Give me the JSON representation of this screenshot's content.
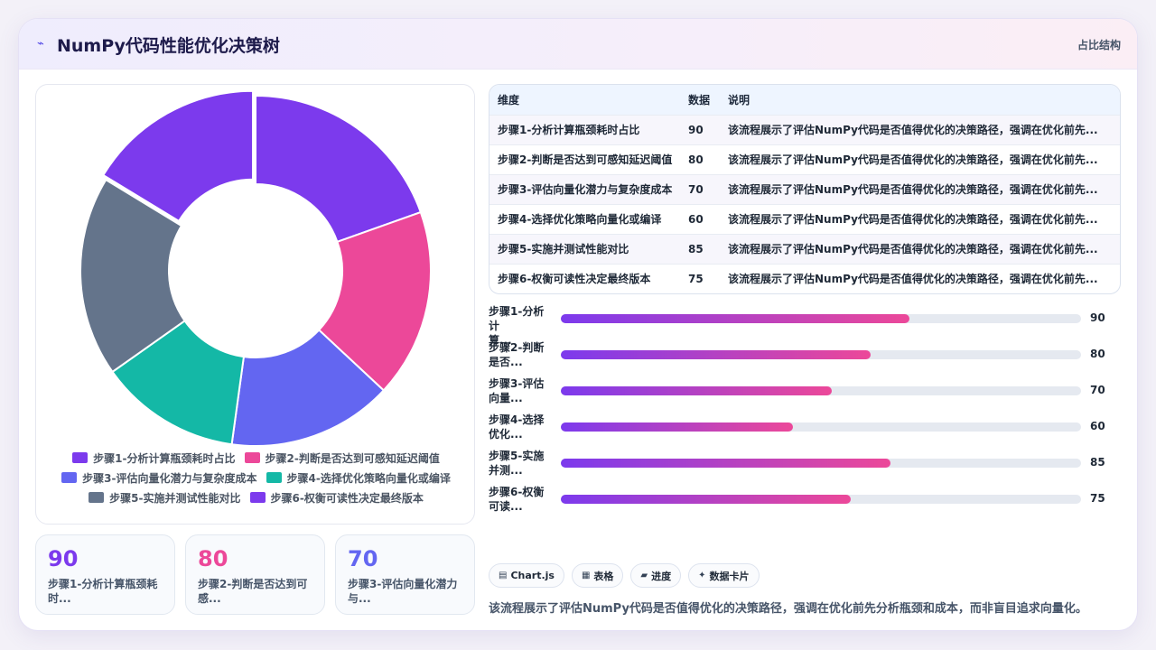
{
  "header": {
    "logo_icon": "chart-line-icon",
    "title": "NumPy代码性能优化决策树",
    "tag": "占比结构"
  },
  "chart_data": {
    "type": "pie",
    "variant": "doughnut",
    "categories": [
      "步骤1-分析计算瓶颈耗时占比",
      "步骤2-判断是否达到可感知延迟阈值",
      "步骤3-评估向量化潜力与复杂度成本",
      "步骤4-选择优化策略向量化或编译",
      "步骤5-实施并测试性能对比",
      "步骤6-权衡可读性决定最终版本"
    ],
    "values": [
      90,
      80,
      70,
      60,
      85,
      75
    ],
    "colors": [
      "#7c3aed",
      "#ec4899",
      "#6366f1",
      "#14b8a6",
      "#64748b",
      "#7c3aed"
    ],
    "legend_position": "bottom",
    "offset_slice_index": 5
  },
  "stat_cards": [
    {
      "value": "90",
      "label": "步骤1-分析计算瓶颈耗时...",
      "color": "#7c3aed"
    },
    {
      "value": "80",
      "label": "步骤2-判断是否达到可感...",
      "color": "#ec4899"
    },
    {
      "value": "70",
      "label": "步骤3-评估向量化潜力与...",
      "color": "#6366f1"
    }
  ],
  "table": {
    "headers": [
      "维度",
      "数据",
      "说明"
    ],
    "rows": [
      [
        "步骤1-分析计算瓶颈耗时占比",
        "90",
        "该流程展示了评估NumPy代码是否值得优化的决策路径，强调在优化前先..."
      ],
      [
        "步骤2-判断是否达到可感知延迟阈值",
        "80",
        "该流程展示了评估NumPy代码是否值得优化的决策路径，强调在优化前先..."
      ],
      [
        "步骤3-评估向量化潜力与复杂度成本",
        "70",
        "该流程展示了评估NumPy代码是否值得优化的决策路径，强调在优化前先..."
      ],
      [
        "步骤4-选择优化策略向量化或编译",
        "60",
        "该流程展示了评估NumPy代码是否值得优化的决策路径，强调在优化前先..."
      ],
      [
        "步骤5-实施并测试性能对比",
        "85",
        "该流程展示了评估NumPy代码是否值得优化的决策路径，强调在优化前先..."
      ],
      [
        "步骤6-权衡可读性决定最终版本",
        "75",
        "该流程展示了评估NumPy代码是否值得优化的决策路径，强调在优化前先..."
      ]
    ]
  },
  "progress": {
    "max": 100,
    "items": [
      {
        "label_line1": "步骤1-分析计",
        "label_line2": "算...",
        "value": 90,
        "fraction": 0.67
      },
      {
        "label_line1": "步骤2-判断",
        "label_line2": "是否...",
        "value": 80,
        "fraction": 0.596
      },
      {
        "label_line1": "步骤3-评估",
        "label_line2": "向量...",
        "value": 70,
        "fraction": 0.521
      },
      {
        "label_line1": "步骤4-选择",
        "label_line2": "优化...",
        "value": 60,
        "fraction": 0.447
      },
      {
        "label_line1": "步骤5-实施",
        "label_line2": "并测...",
        "value": 85,
        "fraction": 0.633
      },
      {
        "label_line1": "步骤6-权衡",
        "label_line2": "可读...",
        "value": 75,
        "fraction": 0.558
      }
    ]
  },
  "chips": [
    {
      "icon": "chart-icon",
      "glyph": "▤",
      "label": "Chart.js"
    },
    {
      "icon": "table-icon",
      "glyph": "▦",
      "label": "表格"
    },
    {
      "icon": "progress-icon",
      "glyph": "▰",
      "label": "进度"
    },
    {
      "icon": "sparkle-icon",
      "glyph": "✦",
      "label": "数据卡片"
    }
  ],
  "description": "该流程展示了评估NumPy代码是否值得优化的决策路径，强调在优化前先分析瓶颈和成本，而非盲目追求向量化。"
}
